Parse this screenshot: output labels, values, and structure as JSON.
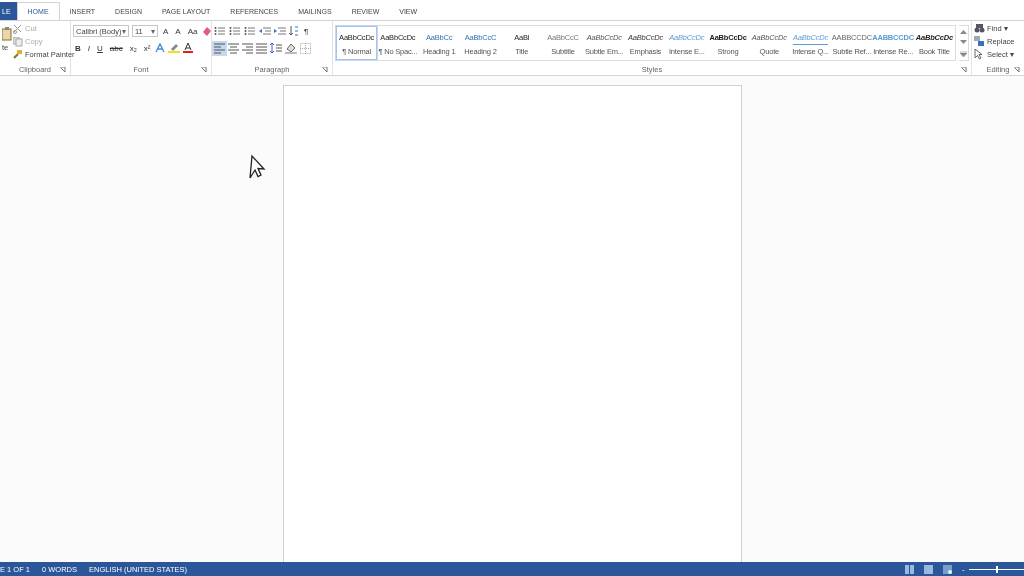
{
  "tabs": [
    {
      "label": "LE",
      "kind": "file",
      "selected": false
    },
    {
      "label": "HOME",
      "kind": "tab",
      "selected": true
    },
    {
      "label": "INSERT",
      "kind": "tab",
      "selected": false
    },
    {
      "label": "DESIGN",
      "kind": "tab",
      "selected": false
    },
    {
      "label": "PAGE LAYOUT",
      "kind": "tab",
      "selected": false
    },
    {
      "label": "REFERENCES",
      "kind": "tab",
      "selected": false
    },
    {
      "label": "MAILINGS",
      "kind": "tab",
      "selected": false
    },
    {
      "label": "REVIEW",
      "kind": "tab",
      "selected": false
    },
    {
      "label": "VIEW",
      "kind": "tab",
      "selected": false
    }
  ],
  "clipboard": {
    "paste_label": "te",
    "items": [
      {
        "label": "Cut",
        "disabled": true
      },
      {
        "label": "Copy",
        "disabled": true
      },
      {
        "label": "Format Painter",
        "disabled": false
      }
    ],
    "group_label": "Clipboard"
  },
  "font": {
    "dropdown_arrow": "▾",
    "font_name": "Calibri (Body)",
    "font_size": "11",
    "row1": [
      "A",
      "A",
      "Aa"
    ],
    "row2": [
      "B",
      "I",
      "U",
      "abc",
      "x₂",
      "x²"
    ],
    "group_label": "Font"
  },
  "paragraph": {
    "group_label": "Paragraph",
    "pilcrow": "¶"
  },
  "styles": {
    "group_label": "Styles",
    "items": [
      {
        "preview": "AaBbCcDc",
        "label": "¶ Normal",
        "kind": "normal",
        "selected": true
      },
      {
        "preview": "AaBbCcDc",
        "label": "¶ No Spac...",
        "kind": "normal",
        "selected": false
      },
      {
        "preview": "AaBbCc",
        "label": "Heading 1",
        "kind": "heading1",
        "selected": false
      },
      {
        "preview": "AaBbCcC",
        "label": "Heading 2",
        "kind": "heading2",
        "selected": false
      },
      {
        "preview": "AaBl",
        "label": "Title",
        "kind": "title",
        "selected": false
      },
      {
        "preview": "AaBbCcC",
        "label": "Subtitle",
        "kind": "subtitle",
        "selected": false
      },
      {
        "preview": "AaBbCcDc",
        "label": "Subtle Em...",
        "kind": "italic",
        "selected": false
      },
      {
        "preview": "AaBbCcDc",
        "label": "Emphasis",
        "kind": "emphasis",
        "selected": false
      },
      {
        "preview": "AaBbCcDc",
        "label": "Intense E...",
        "kind": "intense",
        "selected": false
      },
      {
        "preview": "AaBbCcDc",
        "label": "Strong",
        "kind": "strong",
        "selected": false
      },
      {
        "preview": "AaBbCcDc",
        "label": "Quote",
        "kind": "italic",
        "selected": false
      },
      {
        "preview": "AaBbCcDc",
        "label": "Intense Q...",
        "kind": "intensequote",
        "selected": false
      },
      {
        "preview": "AABBCCDC",
        "label": "Subtle Ref...",
        "kind": "subtleref",
        "selected": false
      },
      {
        "preview": "AABBCCDC",
        "label": "Intense Re...",
        "kind": "intenseref",
        "selected": false
      },
      {
        "preview": "AaBbCcDc",
        "label": "Book Title",
        "kind": "booktitle",
        "selected": false
      }
    ]
  },
  "editing": {
    "group_label": "Editing",
    "items": [
      {
        "label": "Find ▾",
        "kind": "find"
      },
      {
        "label": "Replace",
        "kind": "replace"
      },
      {
        "label": "Select ▾",
        "kind": "select"
      }
    ]
  },
  "status_bar": {
    "items": [
      "E 1 OF 1",
      "0 WORDS",
      "ENGLISH (UNITED STATES)"
    ],
    "zoom_slider": {
      "minus": "-",
      "level": 0.5
    }
  }
}
